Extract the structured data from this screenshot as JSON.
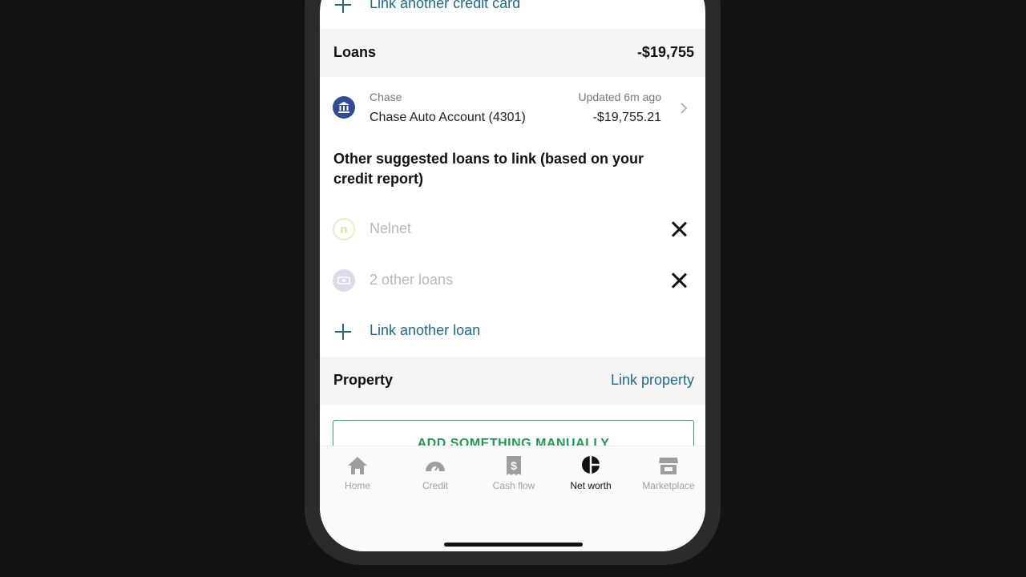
{
  "credit_cards": {
    "link_label": "Link another credit card"
  },
  "loans": {
    "title": "Loans",
    "total": "-$19,755",
    "account": {
      "institution": "Chase",
      "name": "Chase Auto Account (4301)",
      "updated": "Updated 6m ago",
      "balance": "-$19,755.21",
      "icon": "bank-icon"
    },
    "suggested_title": "Other suggested loans to link (based on your credit report)",
    "suggestions": [
      {
        "label": "Nelnet",
        "icon": "nelnet-logo-icon",
        "icon_glyph": "n"
      },
      {
        "label": "2 other loans",
        "icon": "loan-bill-icon"
      }
    ],
    "link_label": "Link another loan"
  },
  "property": {
    "title": "Property",
    "link_label": "Link property"
  },
  "manual_button": {
    "label": "ADD SOMETHING MANUALLY"
  },
  "tabbar": {
    "tabs": [
      {
        "label": "Home",
        "icon": "home-icon",
        "active": false
      },
      {
        "label": "Credit",
        "icon": "gauge-icon",
        "active": false
      },
      {
        "label": "Cash flow",
        "icon": "receipt-dollar-icon",
        "active": false
      },
      {
        "label": "Net worth",
        "icon": "pie-chart-icon",
        "active": true
      },
      {
        "label": "Marketplace",
        "icon": "storefront-icon",
        "active": false
      }
    ]
  },
  "colors": {
    "accent_link": "#1f6a8e",
    "green": "#1f9a5b",
    "bank_icon_bg": "#2f4d96"
  }
}
